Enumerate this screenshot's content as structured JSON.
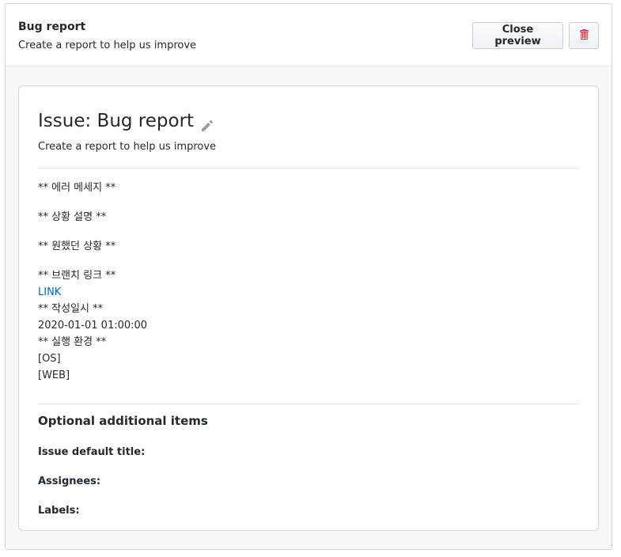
{
  "header": {
    "title": "Bug report",
    "subtitle": "Create a report to help us improve",
    "close_preview_label": "Close preview",
    "delete_icon": "trash-icon"
  },
  "preview": {
    "title": "Issue: Bug report",
    "edit_icon": "pencil-icon",
    "subtitle": "Create a report to help us improve",
    "body": {
      "error_message": "** 에러 메세지 **",
      "situation": "** 상황 설명 **",
      "expected": "** 원했던 상황 **",
      "branch_link_heading": "** 브랜치 링크 **",
      "link_text": "LINK",
      "date_heading": "** 작성일시 **",
      "date_value": "2020-01-01 01:00:00",
      "env_heading": "** 실행 환경 **",
      "env_os": "[OS]",
      "env_web": "[WEB]"
    },
    "optional": {
      "title": "Optional additional items",
      "default_title_label": "Issue default title:",
      "assignees_label": "Assignees:",
      "labels_label": "Labels:"
    }
  },
  "colors": {
    "link": "#0366d6",
    "danger": "#cb2431",
    "border": "#d1d5da"
  }
}
